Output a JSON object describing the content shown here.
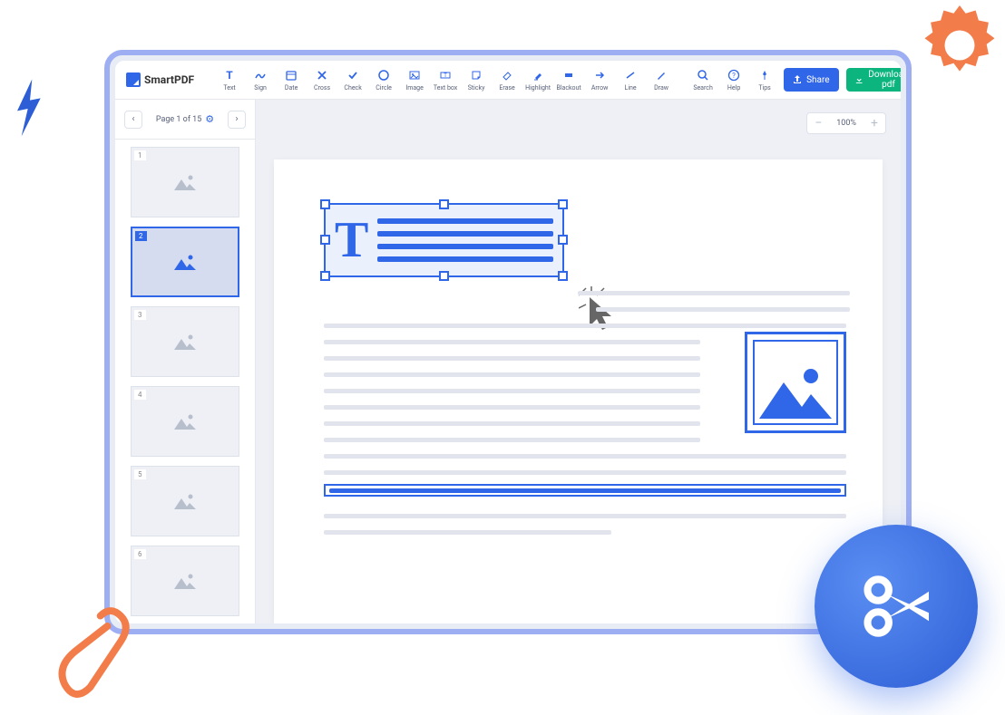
{
  "app": {
    "name": "SmartPDF"
  },
  "toolbar": {
    "tools": [
      {
        "id": "text",
        "label": "Text"
      },
      {
        "id": "sign",
        "label": "Sign"
      },
      {
        "id": "date",
        "label": "Date"
      },
      {
        "id": "cross",
        "label": "Cross"
      },
      {
        "id": "check",
        "label": "Check"
      },
      {
        "id": "circle",
        "label": "Circle"
      },
      {
        "id": "image",
        "label": "Image"
      },
      {
        "id": "textbox",
        "label": "Text box"
      },
      {
        "id": "sticky",
        "label": "Sticky"
      },
      {
        "id": "erase",
        "label": "Erase"
      },
      {
        "id": "highlight",
        "label": "Highlight"
      },
      {
        "id": "blackout",
        "label": "Blackout"
      },
      {
        "id": "arrow",
        "label": "Arrow"
      },
      {
        "id": "line",
        "label": "Line"
      },
      {
        "id": "draw",
        "label": "Draw"
      }
    ],
    "utils": [
      {
        "id": "search",
        "label": "Search"
      },
      {
        "id": "help",
        "label": "Help"
      },
      {
        "id": "tips",
        "label": "Tips"
      }
    ],
    "share": "Share",
    "download": "Download pdf"
  },
  "sidebar": {
    "pageLabel": "Page 1 of 15",
    "thumbs": [
      1,
      2,
      3,
      4,
      5,
      6
    ],
    "active": 2
  },
  "zoom": {
    "value": "100%"
  },
  "textbox": {
    "glyph": "T"
  }
}
